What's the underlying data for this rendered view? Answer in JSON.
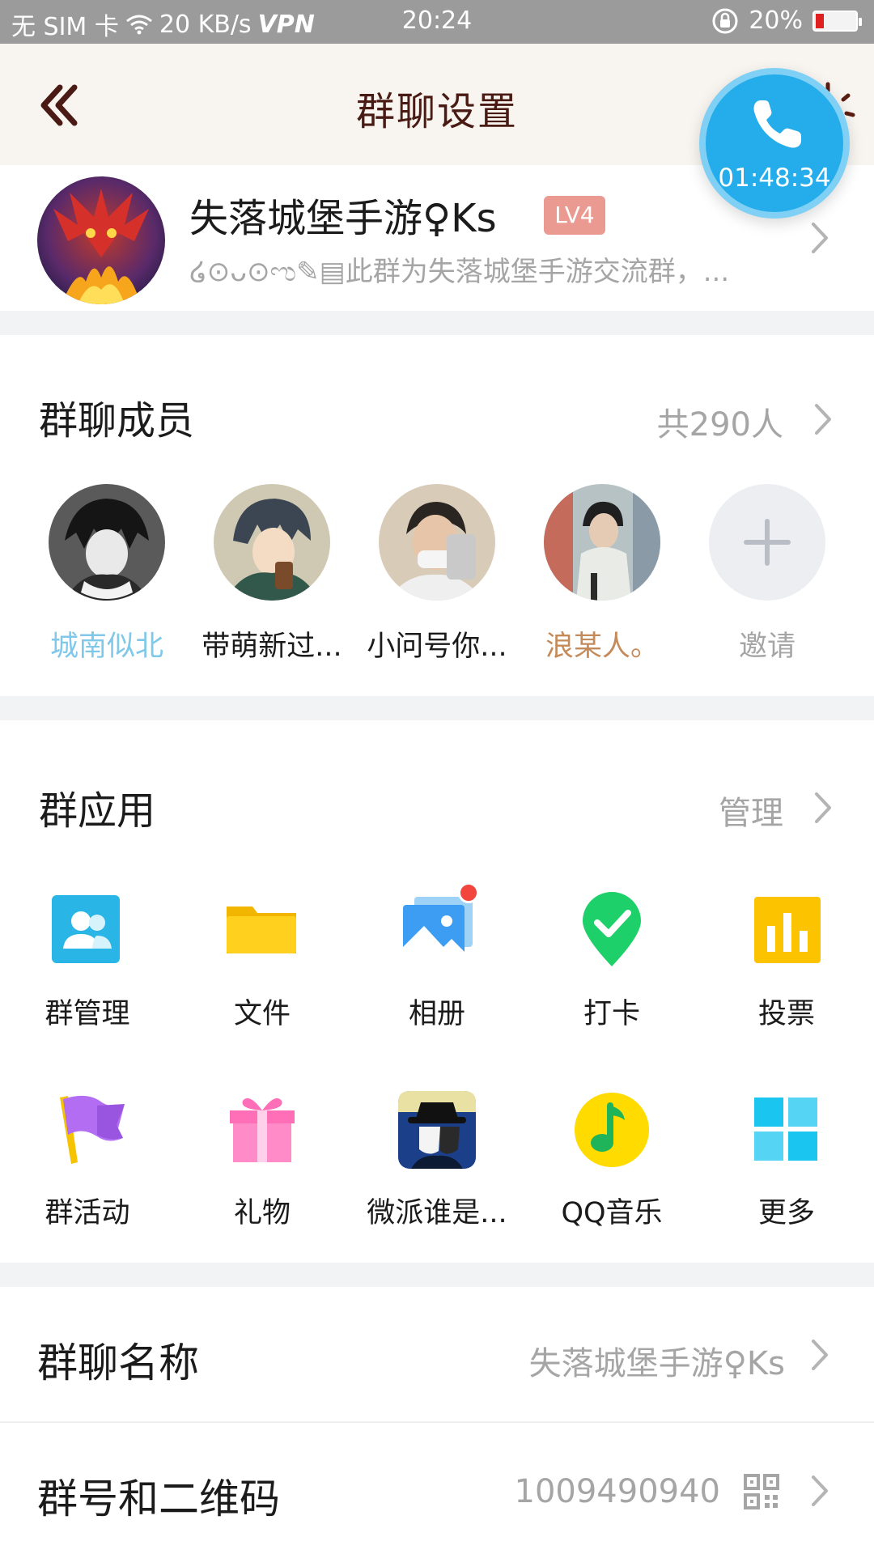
{
  "status_bar": {
    "carrier": "无 SIM 卡",
    "speed": "20 KB/s",
    "vpn": "VPN",
    "time": "20:24",
    "battery_percent": "20%",
    "battery_level": 0.2,
    "icons": [
      "wifi-icon",
      "rotation-lock-icon",
      "battery-icon"
    ]
  },
  "header": {
    "title": "群聊设置",
    "back_icon": "double-chevron-left-icon",
    "decoration_icon": "sun-icon"
  },
  "call_bubble": {
    "icon": "phone-icon",
    "timer": "01:48:34"
  },
  "group": {
    "name": "失落城堡手游♀Ks",
    "level_badge": "LV4",
    "description": "໒⊙ᴗ⊙ಌ✎▤此群为失落城堡手游交流群，..."
  },
  "members": {
    "title": "群聊成员",
    "count": "共290人",
    "list": [
      {
        "name": "城南似北",
        "color": "#7fc8ea"
      },
      {
        "name": "带萌新过...",
        "color": "#1b1b1b"
      },
      {
        "name": "小问号你...",
        "color": "#1b1b1b"
      },
      {
        "name": "浪某人。",
        "color": "#c58a5a"
      }
    ],
    "invite_label": "邀请"
  },
  "apps": {
    "title": "群应用",
    "manage_label": "管理",
    "items": [
      {
        "label": "群管理",
        "icon": "group-manage-icon"
      },
      {
        "label": "文件",
        "icon": "folder-icon"
      },
      {
        "label": "相册",
        "icon": "album-icon",
        "badge": true
      },
      {
        "label": "打卡",
        "icon": "check-in-icon"
      },
      {
        "label": "投票",
        "icon": "vote-icon"
      },
      {
        "label": "群活动",
        "icon": "flag-icon"
      },
      {
        "label": "礼物",
        "icon": "gift-icon"
      },
      {
        "label": "微派谁是...",
        "icon": "spy-game-icon"
      },
      {
        "label": "QQ音乐",
        "icon": "qq-music-icon"
      },
      {
        "label": "更多",
        "icon": "more-grid-icon"
      }
    ]
  },
  "rows": {
    "group_name": {
      "label": "群聊名称",
      "value": "失落城堡手游♀Ks"
    },
    "group_id": {
      "label": "群号和二维码",
      "value": "1009490940",
      "icon": "qr-code-icon"
    }
  },
  "colors": {
    "accent_blue": "#25acea",
    "badge_red": "#eb9a92",
    "header_title": "#4a1a14"
  }
}
